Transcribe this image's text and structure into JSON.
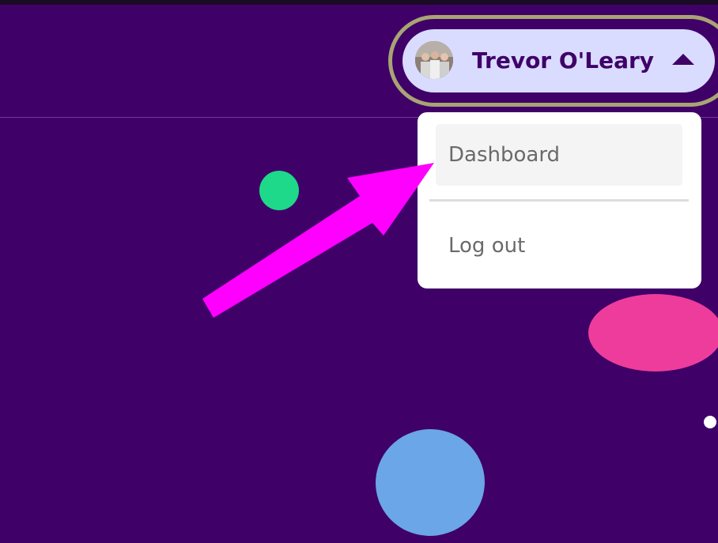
{
  "header": {
    "user": {
      "name": "Trevor O'Leary",
      "avatar_icon": "user-avatar-photo",
      "toggle_icon": "caret-up-icon"
    }
  },
  "user_menu": {
    "items": [
      {
        "label": "Dashboard",
        "state": "hovered"
      },
      {
        "label": "Log out"
      }
    ]
  },
  "annotation": {
    "icon": "arrow-pointer-icon",
    "color": "#ff00ff"
  },
  "colors": {
    "background": "#3f0068",
    "pill": "#d9dcff",
    "pill_ring": "#a8a474",
    "dot_green": "#1ed98a",
    "blob_pink": "#ee3c9d",
    "blob_blue": "#6aa6e8"
  }
}
